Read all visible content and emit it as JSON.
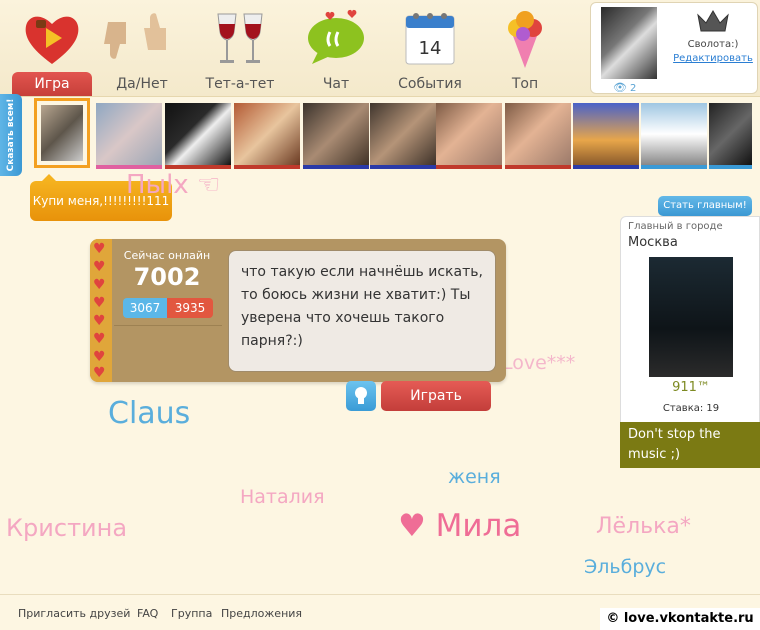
{
  "nav": {
    "items": [
      {
        "label": "Игра",
        "icon": "heart-play-icon",
        "active": true
      },
      {
        "label": "Да/Нет",
        "icon": "thumbs-icon"
      },
      {
        "label": "Тет-а-тет",
        "icon": "wine-glasses-icon"
      },
      {
        "label": "Чат",
        "icon": "chat-bubble-icon"
      },
      {
        "label": "События",
        "icon": "calendar-icon",
        "calendar_day": "14"
      },
      {
        "label": "Топ",
        "icon": "bouquet-icon"
      }
    ]
  },
  "profile": {
    "name": "Сволота:)",
    "edit_label": "Редактировать",
    "views": "2"
  },
  "strip": {
    "say_all": "Сказать всем!",
    "buy_me": "Купи меня,!!!!!!!!!111"
  },
  "names": {
    "n1": "Пыlx ☜",
    "n2": "Claus",
    "n3": "Love***",
    "n4": "женя",
    "n5": "Наталия",
    "n6": "Кристина",
    "n7": "♥ Мила",
    "n8": "Лёлька*",
    "n9": "Эльбрус"
  },
  "online": {
    "label": "Сейчас онлайн",
    "count": "7002",
    "boys": "3067",
    "girls": "3935"
  },
  "bubble_text": "что такую если начнёшь искать, то боюсь жизни не хватит:) Ты уверена что хочешь такого парня?:)",
  "actions": {
    "play": "Играть"
  },
  "main_city": {
    "become_main": "Стать главным!",
    "caption": "Главный в городе",
    "city": "Москва",
    "points": "911™",
    "bid": "Ставка: 19",
    "status": "Don't stop the music ;)"
  },
  "footer": {
    "invite": "Пригласить друзей",
    "faq": "FAQ",
    "group": "Группа",
    "suggestions": "Предложения",
    "copyright": "© love.vkontakte.ru"
  },
  "colors": {
    "accent_red": "#d2453f",
    "accent_blue": "#3b98d4",
    "panel_brown": "#b39563"
  }
}
